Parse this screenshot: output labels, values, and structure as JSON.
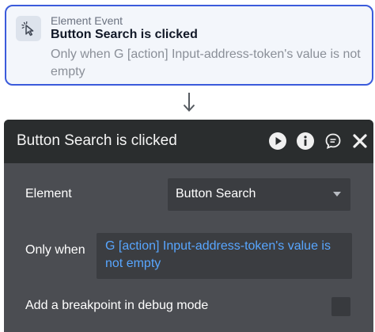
{
  "event_card": {
    "type_label": "Element Event",
    "title": "Button Search is clicked",
    "condition": "Only when G [action] Input-address-token's value is not empty",
    "icon": "cursor-click-icon"
  },
  "panel": {
    "title": "Button Search is clicked",
    "header_icons": [
      "play-icon",
      "info-icon",
      "comment-icon",
      "close-icon"
    ],
    "element_label": "Element",
    "element_value": "Button Search",
    "only_when_label": "Only when",
    "only_when_value": "G [action] Input-address-token's value is not empty",
    "breakpoint_label": "Add a breakpoint in debug mode",
    "breakpoint_checked": false
  },
  "colors": {
    "card_border": "#3b5bdb",
    "panel_header": "#2a2d2e",
    "panel_body": "#4b4d52",
    "field_bg": "#3b3d41",
    "condition_link": "#58a6ff"
  }
}
